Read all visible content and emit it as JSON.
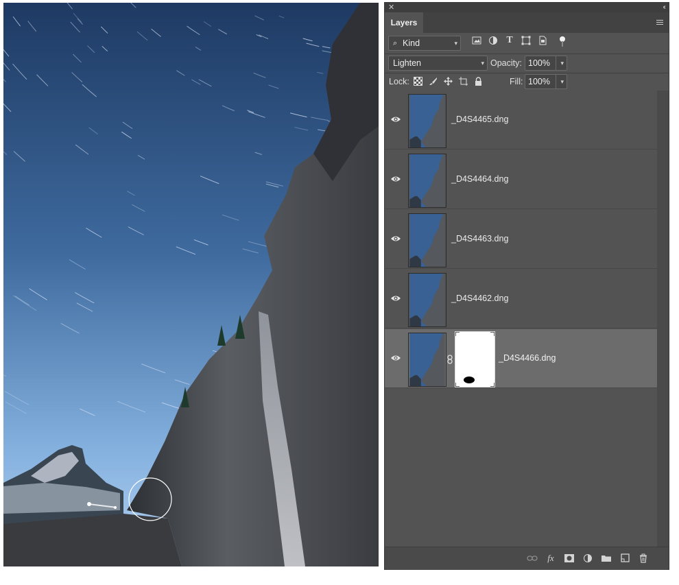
{
  "panel": {
    "close_glyph": "✕",
    "collapse_glyph": "‹‹",
    "tab_label": "Layers",
    "menu_icon": "panel-menu-icon"
  },
  "filter": {
    "kind_label": "Kind",
    "filter_icons": [
      "image-filter-icon",
      "adjustment-filter-icon",
      "type-filter-icon",
      "shape-filter-icon",
      "smart-object-filter-icon",
      "filter-toggle-icon"
    ]
  },
  "blend": {
    "mode": "Lighten",
    "opacity_label": "Opacity:",
    "opacity_value": "100%"
  },
  "lock": {
    "label": "Lock:",
    "icons": [
      "lock-transparent-pixels-icon",
      "lock-image-pixels-icon",
      "lock-position-icon",
      "lock-artboard-icon",
      "lock-all-icon"
    ],
    "fill_label": "Fill:",
    "fill_value": "100%"
  },
  "layers": [
    {
      "name": "_D4S4465.dng",
      "visible": true,
      "selected": false,
      "has_mask": false
    },
    {
      "name": "_D4S4464.dng",
      "visible": true,
      "selected": false,
      "has_mask": false
    },
    {
      "name": "_D4S4463.dng",
      "visible": true,
      "selected": false,
      "has_mask": false
    },
    {
      "name": "_D4S4462.dng",
      "visible": true,
      "selected": false,
      "has_mask": false
    },
    {
      "name": "_D4S4466.dng",
      "visible": true,
      "selected": true,
      "has_mask": true
    }
  ],
  "bottom_icons": [
    "link-layers-icon",
    "fx-icon",
    "add-mask-icon",
    "adjustment-layer-icon",
    "group-folder-icon",
    "new-layer-icon",
    "trash-icon"
  ],
  "bottom_fx_glyph": "fx",
  "colors": {
    "panel_bg": "#535353",
    "selected_row": "#6c6c6c",
    "sky_top": "#1f3d66",
    "sky_bottom": "#9ec3ea"
  }
}
